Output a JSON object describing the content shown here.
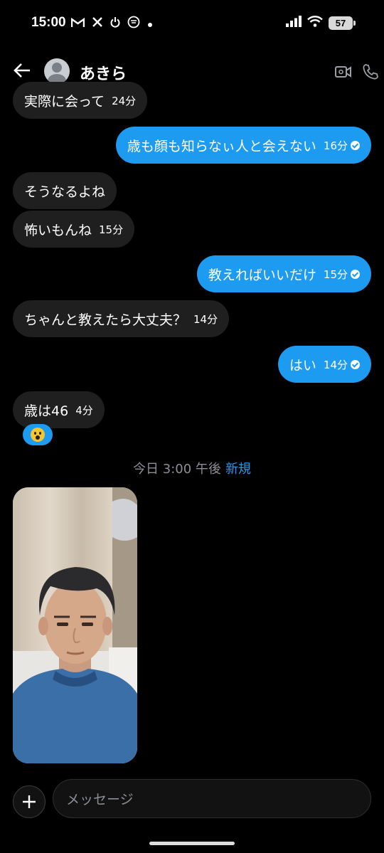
{
  "status_bar": {
    "time": "15:00",
    "left_icons": [
      "gmail-icon",
      "x-icon",
      "power-icon",
      "vpn-icon",
      "dot-icon"
    ],
    "battery": "57"
  },
  "header": {
    "back_icon": "back-arrow-icon",
    "contact_name": "あきら",
    "actions": [
      "video-call-icon",
      "phone-icon"
    ]
  },
  "messages": [
    {
      "direction": "in",
      "text": "実際に会って",
      "time": "24分"
    },
    {
      "direction": "out",
      "text": "歳も顔も知らなぃ人と会えない",
      "time": "16分",
      "read": true
    },
    {
      "direction": "in",
      "text": "そうなるよね",
      "time": ""
    },
    {
      "direction": "in",
      "text": "怖いもんね",
      "time": "15分"
    },
    {
      "direction": "out",
      "text": "教えればいいだけ",
      "time": "15分",
      "read": true
    },
    {
      "direction": "in",
      "text": "ちゃんと教えたら大丈夫？",
      "time": "14分"
    },
    {
      "direction": "out",
      "text": "はい",
      "time": "14分",
      "read": true
    },
    {
      "direction": "in",
      "text": "歳は46",
      "time": "4分"
    }
  ],
  "reaction": {
    "emoji": "astonished-face",
    "color": "#1d9bf0"
  },
  "divider": {
    "text": "今日 3:00 午後",
    "new_label": "新規"
  },
  "photo": {
    "description_icon": "selfie-photo"
  },
  "composer": {
    "placeholder": "メッセージ",
    "add_icon": "plus-icon"
  },
  "colors": {
    "outgoing": "#1d9bf0",
    "incoming": "#1f1f1f",
    "background": "#000000"
  }
}
